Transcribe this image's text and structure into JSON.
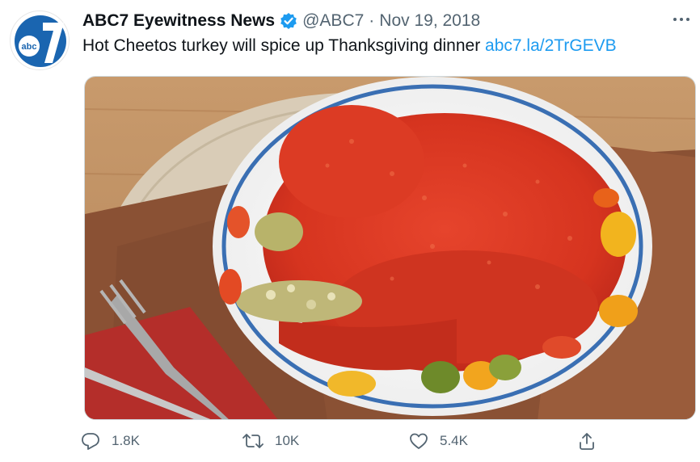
{
  "tweet": {
    "author_name": "ABC7 Eyewitness News",
    "handle": "@ABC7",
    "separator": "·",
    "date": "Nov 19, 2018",
    "text": "Hot Cheetos turkey will spice up Thanksgiving dinner",
    "link": "abc7.la/2TrGEVB",
    "avatar_text": "abc"
  },
  "actions": {
    "replies": "1.8K",
    "retweets": "10K",
    "likes": "5.4K"
  },
  "colors": {
    "link": "#1d9bf0",
    "verified": "#1d9bf0",
    "secondary_text": "#536471",
    "brand": "#1a65b0"
  },
  "icons": [
    "abc7-logo",
    "verified-badge-icon",
    "more-icon",
    "reply-icon",
    "retweet-icon",
    "like-icon",
    "share-icon"
  ]
}
